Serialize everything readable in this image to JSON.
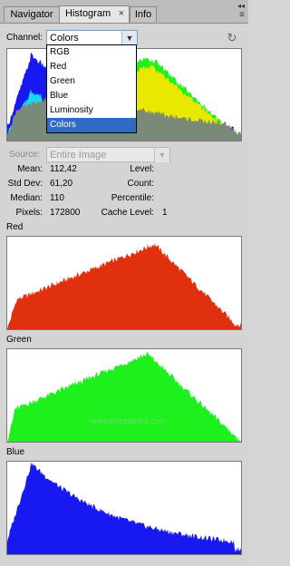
{
  "tabs": [
    {
      "label": "Navigator"
    },
    {
      "label": "Histogram",
      "close": "×"
    },
    {
      "label": "Info"
    }
  ],
  "top_icons": {
    "collapse": "◂◂",
    "menu": "≡"
  },
  "channel": {
    "label": "Channel:",
    "selected": "Colors",
    "options": [
      "RGB",
      "Red",
      "Green",
      "Blue",
      "Luminosity",
      "Colors"
    ]
  },
  "source": {
    "label": "Source:",
    "value": "Entire Image"
  },
  "stats": {
    "mean": {
      "label": "Mean:",
      "value": "112,42"
    },
    "std_dev": {
      "label": "Std Dev:",
      "value": "61,20"
    },
    "median": {
      "label": "Median:",
      "value": "110"
    },
    "pixels": {
      "label": "Pixels:",
      "value": "172800"
    },
    "level": {
      "label": "Level:",
      "value": ""
    },
    "count": {
      "label": "Count:",
      "value": ""
    },
    "percentile": {
      "label": "Percentile:",
      "value": ""
    },
    "cache_level": {
      "label": "Cache Level:",
      "value": "1"
    }
  },
  "channels_panels": [
    {
      "label": "Red",
      "color": "#e0300e"
    },
    {
      "label": "Green",
      "color": "#1ef01e"
    },
    {
      "label": "Blue",
      "color": "#1818f0"
    }
  ],
  "watermark": "www.skiptalkers.com",
  "colors": {
    "composite_gray": "#7a8a78",
    "yellow": "#e8e800",
    "red": "#e0300e",
    "green": "#1ef01e",
    "blue": "#1818f0",
    "cyan": "#18d8f0"
  }
}
